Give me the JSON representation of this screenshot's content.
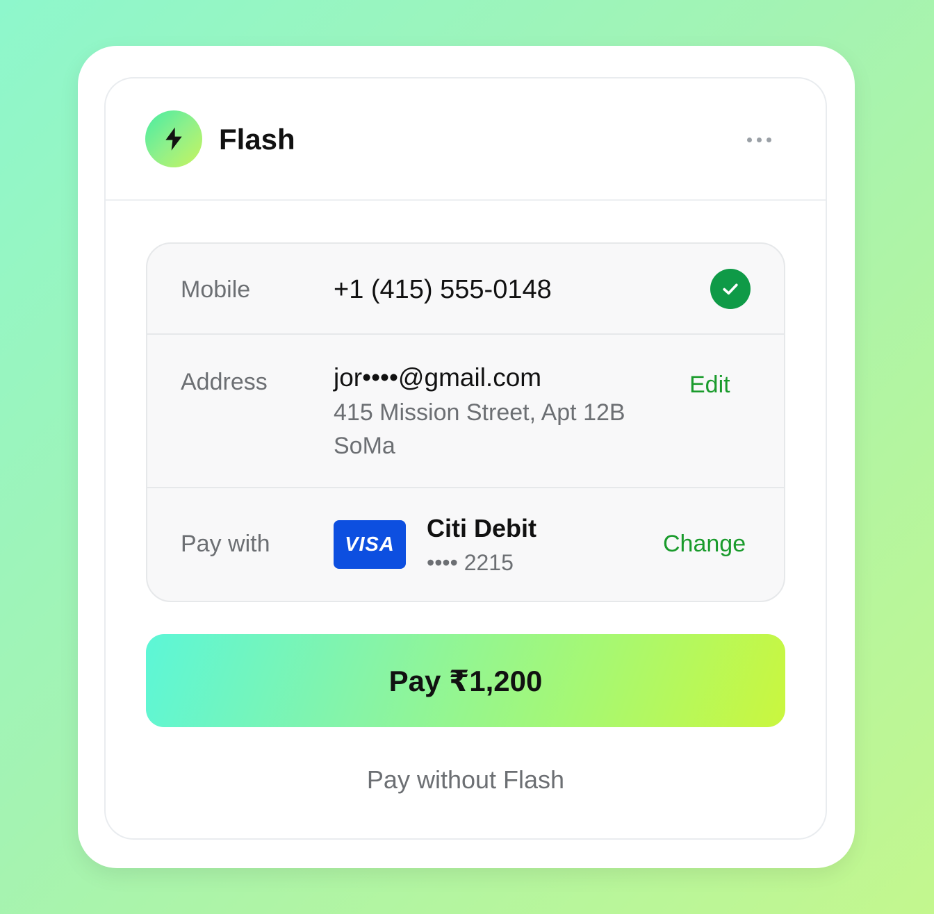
{
  "app": {
    "brand": "Flash",
    "logo_icon": "lightning-bolt-icon",
    "menu_icon": "more-horizontal-icon"
  },
  "details": {
    "mobile": {
      "label": "Mobile",
      "value": "+1 (415) 555-0148",
      "status_icon": "check-circle-icon"
    },
    "address": {
      "label": "Address",
      "email": "jor••••@gmail.com",
      "line1": "415 Mission Street, Apt 12B",
      "line2": "SoMa",
      "action": "Edit"
    },
    "payment": {
      "label": "Pay with",
      "card_brand": "VISA",
      "card_name": "Citi Debit",
      "card_number": "•••• 2215",
      "action": "Change"
    }
  },
  "actions": {
    "pay_label": "Pay ₹1,200",
    "alternate_label": "Pay without Flash"
  },
  "colors": {
    "accent_green": "#1a9b2c",
    "verified_green": "#0f9a47",
    "visa_blue": "#0d4fe0"
  }
}
